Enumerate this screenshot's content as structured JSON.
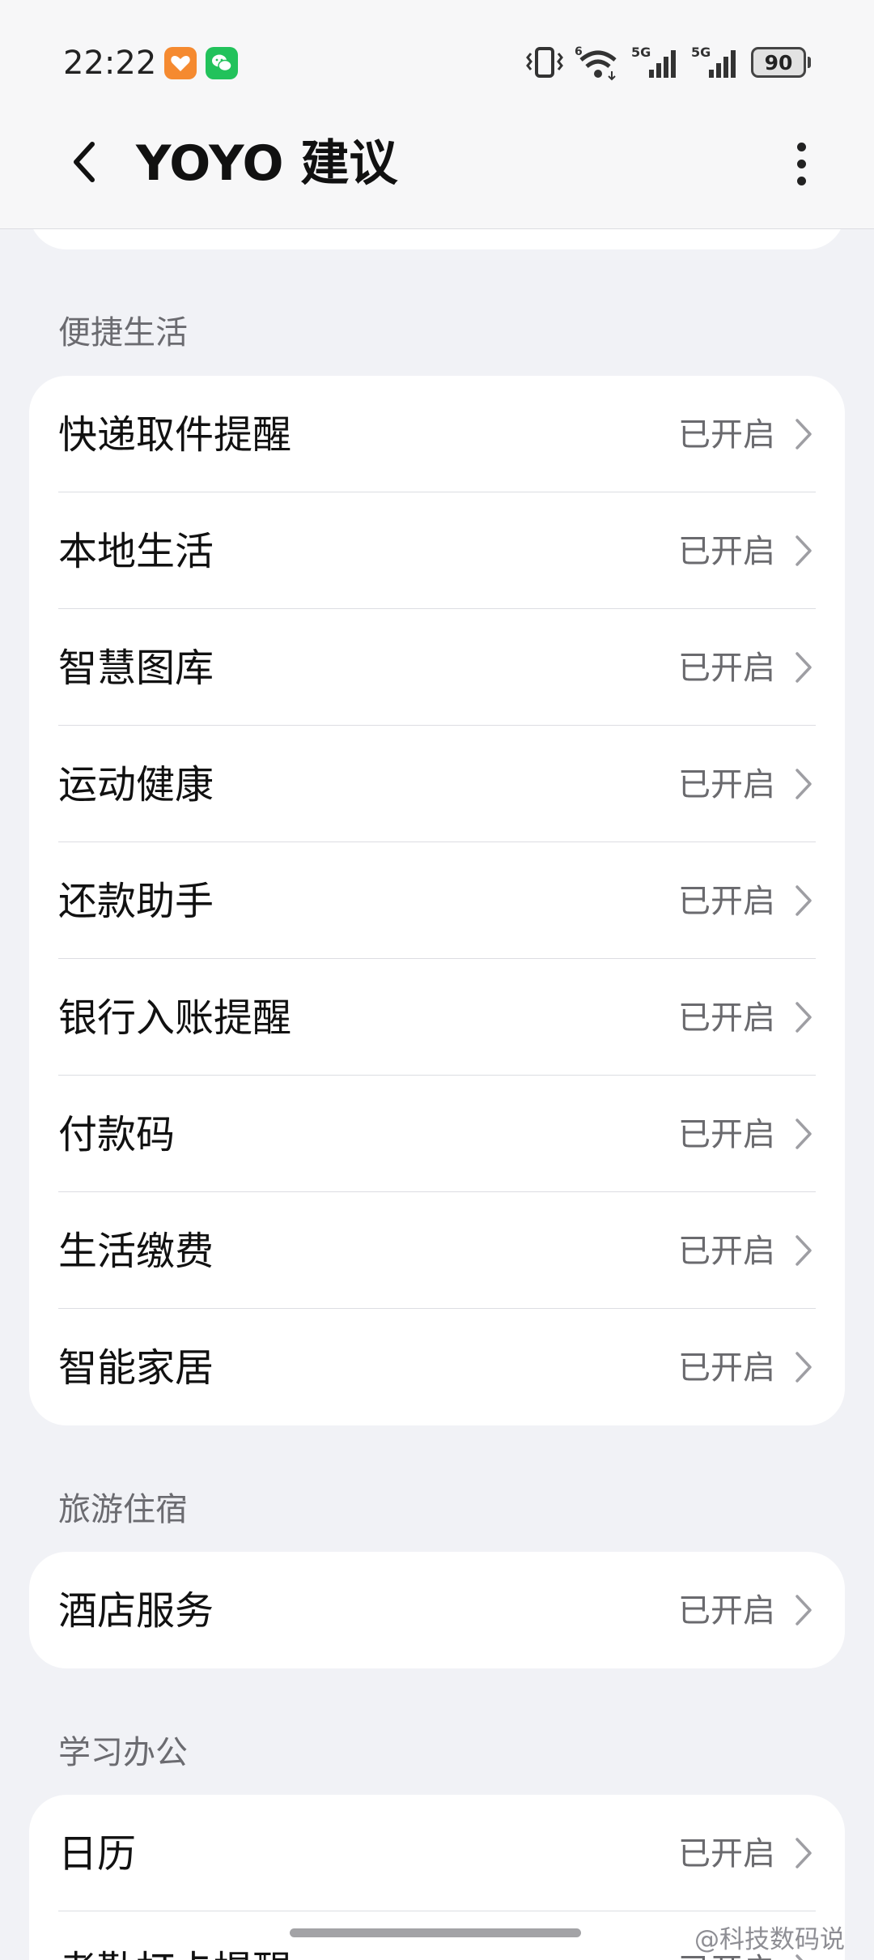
{
  "status_bar": {
    "time": "22:22",
    "network_1": "5G",
    "network_2": "5G",
    "wifi_badge": "6",
    "battery": "90",
    "notification_icons": [
      "health-app-icon",
      "wechat-icon"
    ]
  },
  "app_bar": {
    "title": "YOYO 建议",
    "back_icon": "chevron-left-icon",
    "more_icon": "more-vertical-icon"
  },
  "sections": [
    {
      "header": "便捷生活",
      "items": [
        {
          "label": "快递取件提醒",
          "value": "已开启"
        },
        {
          "label": "本地生活",
          "value": "已开启"
        },
        {
          "label": "智慧图库",
          "value": "已开启"
        },
        {
          "label": "运动健康",
          "value": "已开启"
        },
        {
          "label": "还款助手",
          "value": "已开启"
        },
        {
          "label": "银行入账提醒",
          "value": "已开启"
        },
        {
          "label": "付款码",
          "value": "已开启"
        },
        {
          "label": "生活缴费",
          "value": "已开启"
        },
        {
          "label": "智能家居",
          "value": "已开启"
        }
      ]
    },
    {
      "header": "旅游住宿",
      "items": [
        {
          "label": "酒店服务",
          "value": "已开启"
        }
      ]
    },
    {
      "header": "学习办公",
      "items": [
        {
          "label": "日历",
          "value": "已开启"
        },
        {
          "label": "考勤打卡提醒",
          "value": "已开启"
        }
      ]
    }
  ],
  "watermark": "@科技数码说",
  "colors": {
    "page_background": "#f1f2f6",
    "card_background": "#ffffff",
    "header_text": "#6b6b70",
    "value_text": "#6a6a6e",
    "divider": "#dcdde2",
    "health_icon": "#f58a30",
    "wechat_icon": "#22c25b"
  }
}
